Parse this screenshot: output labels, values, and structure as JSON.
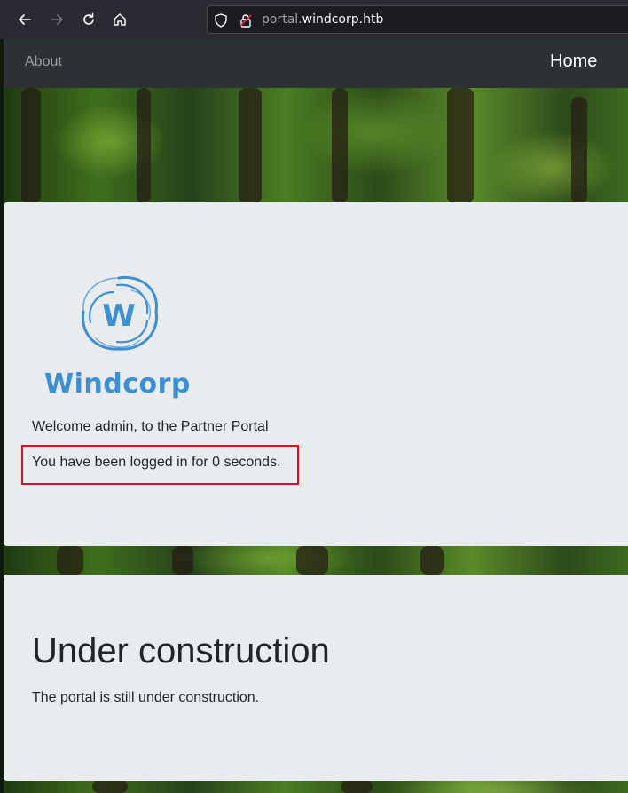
{
  "browser": {
    "url_subdomain": "portal.",
    "url_domain": "windcorp.htb",
    "buttons": {
      "back": "back-arrow-icon",
      "forward": "forward-arrow-icon",
      "reload": "reload-icon",
      "home": "home-icon"
    }
  },
  "nav": {
    "about": "About",
    "home": "Home"
  },
  "welcome_card": {
    "logo_text": "Windcorp",
    "welcome": "Welcome admin, to the Partner Portal",
    "login_time": "You have been logged in for 0 seconds."
  },
  "construction_card": {
    "title": "Under construction",
    "text": "The portal is still under construction."
  },
  "colors": {
    "highlight": "#e0101a",
    "logo_blue": "#3d8fd1",
    "card_bg": "#e9ecef",
    "nav_bg": "#2c3136"
  }
}
